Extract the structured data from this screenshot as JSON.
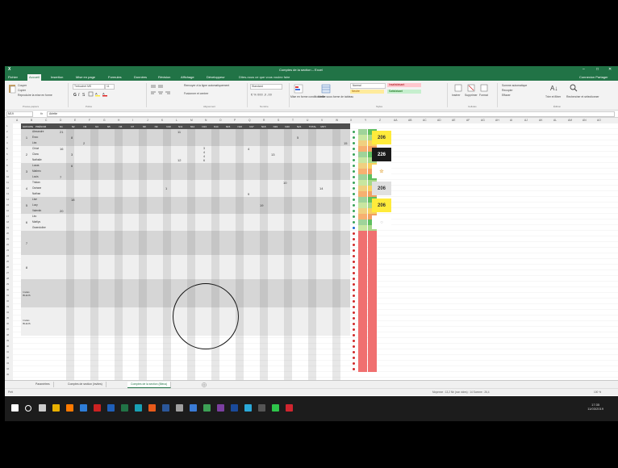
{
  "window": {
    "app_letter": "X",
    "title": "Comptes de la section – Excel",
    "controls": [
      "–",
      "□",
      "✕"
    ]
  },
  "ribbon_tabs": [
    "Fichier",
    "Accueil",
    "Insertion",
    "Mise en page",
    "Formules",
    "Données",
    "Révision",
    "Affichage",
    "Développeur"
  ],
  "active_tab": "Accueil",
  "tell_me": "Dites-nous ce que vous voulez faire",
  "share": "Connexion  Partager",
  "ribbon": {
    "paste_items": [
      "Couper",
      "Copier",
      "Reproduire la mise en forme"
    ],
    "font_name": "Trebuchet MS",
    "font_size": "11",
    "wrap": "Renvoyer à la ligne automatiquement",
    "merge": "Fusionner et centrer",
    "number_format": "Standard",
    "styles": [
      {
        "label": "Normal",
        "bg": "#ffffff"
      },
      {
        "label": "Insatisfaisant",
        "bg": "#ffc7ce"
      },
      {
        "label": "Neutre",
        "bg": "#ffeb9c"
      },
      {
        "label": "Satisfaisant",
        "bg": "#c6efce"
      }
    ],
    "groups": [
      "Presse-papiers",
      "Police",
      "Alignement",
      "Nombre",
      "Styles",
      "Cellules",
      "Édition"
    ],
    "cells_items": [
      "Insérer",
      "Supprimer",
      "Format"
    ],
    "edit_items": [
      "Somme automatique",
      "Recopier",
      "Effacer",
      "Trier et filtrer",
      "Rechercher et sélectionner"
    ],
    "cf_label": "Mise en forme conditionnelle",
    "table_label": "Mettre sous forme de tableau"
  },
  "formula_bar": {
    "name_box": "M19",
    "fx": "fx",
    "content": "Arlette"
  },
  "column_letters": [
    "A",
    "B",
    "C",
    "D",
    "E",
    "F",
    "G",
    "H",
    "I",
    "J",
    "K",
    "L",
    "M",
    "N",
    "O",
    "P",
    "Q",
    "R",
    "S",
    "T",
    "U",
    "V",
    "W",
    "X",
    "Y",
    "Z",
    "AA",
    "AB",
    "AC",
    "AD",
    "AE",
    "AF",
    "AG",
    "AH",
    "AI",
    "AJ",
    "AK",
    "AL",
    "AM",
    "AN",
    "AO"
  ],
  "header_row": [
    "GROUPE",
    "PRÉNOM",
    "N1",
    "N2",
    "N3",
    "N4",
    "N5",
    "N6",
    "N7",
    "N8",
    "N9",
    "N10",
    "N11",
    "N12",
    "N13",
    "N14",
    "N15",
    "N16",
    "N17",
    "N18",
    "N19",
    "N20",
    "N21",
    "TOTAL",
    "MOY"
  ],
  "groups": [
    {
      "id": "1",
      "members": [
        "Alexandre",
        "Enzo",
        "Léa"
      ],
      "score": "206",
      "score_bg": "#ffeb3b",
      "score_color": "#333"
    },
    {
      "id": "2",
      "members": [
        "Chloé",
        "Clara",
        "Nathalie"
      ],
      "score": "226",
      "score_bg": "#1a1a1a",
      "score_color": "#ffffff"
    },
    {
      "id": "3",
      "members": [
        "Lucas",
        "Mathéo",
        "Louis"
      ],
      "score": "☆",
      "score_bg": "#ffffff",
      "score_color": "#e0a030"
    },
    {
      "id": "4",
      "members": [
        "Tristan",
        "Océane",
        "Nathan"
      ],
      "score": "206",
      "score_bg": "#e0e0e0",
      "score_color": "#333"
    },
    {
      "id": "5",
      "members": [
        "Lise",
        "Lucy",
        "Valentin"
      ],
      "score": "206",
      "score_bg": "#ffeb3b",
      "score_color": "#333"
    },
    {
      "id": "6",
      "members": [
        "Léo",
        "Maëlys",
        "Gwendoline"
      ],
      "score": "○",
      "score_bg": "#ffffff",
      "score_color": "#bbb"
    },
    {
      "id": "7",
      "members": [],
      "score": "",
      "score_bg": "#ffffff",
      "score_color": "#333"
    },
    {
      "id": "8",
      "members": [],
      "score": "",
      "score_bg": "#ffffff",
      "score_color": "#333"
    },
    {
      "id": "Invités\nBLEUS",
      "members": [],
      "score": "",
      "score_bg": "#ffffff",
      "score_color": "#333"
    },
    {
      "id": "Invités\nBLEUS",
      "members": [],
      "score": "",
      "score_bg": "#ffffff",
      "score_color": "#333"
    }
  ],
  "cell_values": [
    "21",
    "8",
    "2",
    "11",
    "5",
    "15",
    "16",
    "3",
    "12",
    "4",
    "13",
    "7",
    "6",
    "1",
    "9",
    "10",
    "14",
    "20",
    "18",
    "19"
  ],
  "circle_values": [
    "3",
    "4",
    "4",
    "6"
  ],
  "sheet_tabs": [
    "Paramètres",
    "Comptes de section (invites)",
    "Comptes de la section (Bleus)"
  ],
  "active_sheet": "Comptes de la section (Bleus)",
  "status": {
    "left": "Prêt",
    "right": "Moyenne : 13,2   Nb (non vides) : 14   Somme : 26,4",
    "zoom": "100 %"
  },
  "taskbar": {
    "time": "17:35",
    "date": "11/03/2019",
    "icons": [
      {
        "name": "windows-icon",
        "color": "#ffffff"
      },
      {
        "name": "search-icon",
        "color": "#ffffff"
      },
      {
        "name": "task-view-icon",
        "color": "#cccccc"
      },
      {
        "name": "chrome-icon",
        "color": "#e8b000"
      },
      {
        "name": "firefox-icon",
        "color": "#ff7a00"
      },
      {
        "name": "edge-icon",
        "color": "#2e7dd7"
      },
      {
        "name": "app-red-icon",
        "color": "#cc2222"
      },
      {
        "name": "outlook-icon",
        "color": "#1f5fb8"
      },
      {
        "name": "excel-icon",
        "color": "#217346"
      },
      {
        "name": "app-teal-icon",
        "color": "#18a0b4"
      },
      {
        "name": "app-orange-icon",
        "color": "#e85a1a"
      },
      {
        "name": "word-icon",
        "color": "#2b579a"
      },
      {
        "name": "app-gray-icon",
        "color": "#a0a0a0"
      },
      {
        "name": "app-blue-icon",
        "color": "#3a7bd5"
      },
      {
        "name": "app-green-icon",
        "color": "#3ca055"
      },
      {
        "name": "app-purple-icon",
        "color": "#7b3fa0"
      },
      {
        "name": "app-darkblue-icon",
        "color": "#1a4a9a"
      },
      {
        "name": "app-cyan-icon",
        "color": "#2aa8d8"
      },
      {
        "name": "app-black-icon",
        "color": "#555555"
      },
      {
        "name": "app-lime-icon",
        "color": "#2ec44a"
      },
      {
        "name": "app-crimson-icon",
        "color": "#d0252f"
      }
    ]
  }
}
